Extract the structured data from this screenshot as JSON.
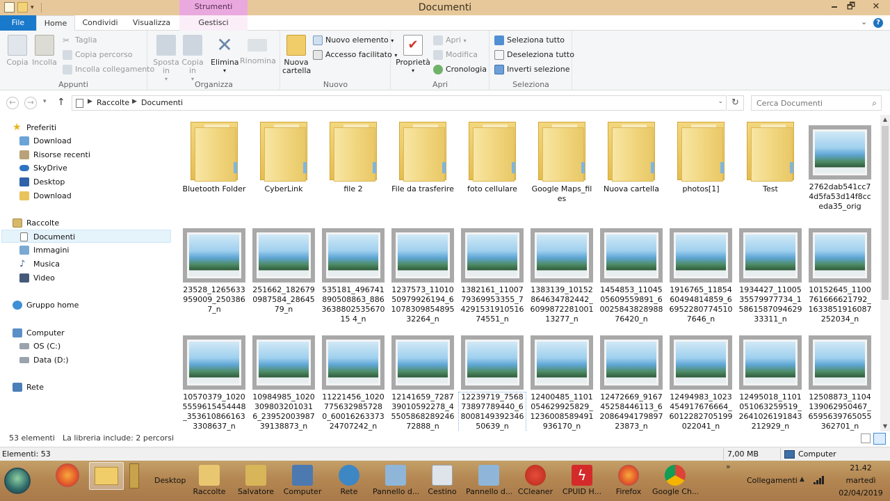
{
  "window": {
    "title": "Documenti",
    "contextual_tab_head": "Strumenti raccolte",
    "minimize": "🗕",
    "maximize": "🗗",
    "close": "✕"
  },
  "tabs": {
    "file": "File",
    "home": "Home",
    "share": "Condividi",
    "view": "Visualizza",
    "manage": "Gestisci",
    "help": "?"
  },
  "ribbon": {
    "clipboard": {
      "label": "Appunti",
      "copy": "Copia",
      "paste": "Incolla",
      "cut": "Taglia",
      "copy_path": "Copia percorso",
      "paste_link": "Incolla collegamento"
    },
    "organize": {
      "label": "Organizza",
      "move_to": "Sposta in",
      "copy_to": "Copia in",
      "delete": "Elimina",
      "rename": "Rinomina"
    },
    "new": {
      "label": "Nuovo",
      "new_folder": "Nuova cartella",
      "new_item": "Nuovo elemento",
      "easy_access": "Accesso facilitato"
    },
    "open": {
      "label": "Apri",
      "properties": "Proprietà",
      "open": "Apri",
      "edit": "Modifica",
      "history": "Cronologia"
    },
    "select": {
      "label": "Seleziona",
      "select_all": "Seleziona tutto",
      "select_none": "Deseleziona tutto",
      "invert": "Inverti selezione"
    }
  },
  "address": {
    "crumbs": [
      "Raccolte",
      "Documenti"
    ],
    "search_placeholder": "Cerca Documenti"
  },
  "navpane": {
    "favorites": "Preferiti",
    "fav_items": [
      "Download",
      "Risorse recenti",
      "SkyDrive",
      "Desktop",
      "Download"
    ],
    "libraries": "Raccolte",
    "lib_items": [
      "Documenti",
      "Immagini",
      "Musica",
      "Video"
    ],
    "homegroup": "Gruppo home",
    "computer": "Computer",
    "drives": [
      "OS (C:)",
      "Data (D:)"
    ],
    "network": "Rete"
  },
  "files": [
    {
      "type": "folder",
      "name": "Bluetooth Folder"
    },
    {
      "type": "folder",
      "name": "CyberLink"
    },
    {
      "type": "folder",
      "name": "file 2"
    },
    {
      "type": "folder",
      "name": "File da trasferire"
    },
    {
      "type": "folder",
      "name": "foto cellulare"
    },
    {
      "type": "folder",
      "name": "Google Maps_files"
    },
    {
      "type": "folder",
      "name": "Nuova cartella"
    },
    {
      "type": "folder",
      "name": "photos[1]"
    },
    {
      "type": "folder",
      "name": "Test"
    },
    {
      "type": "image",
      "name": "2762dab541cc74d5fa53d14f8cceda35_orig"
    },
    {
      "type": "image",
      "name": "23528_1265633959009_2503867_n"
    },
    {
      "type": "image",
      "name": "251662_1826790987584_2864579_n"
    },
    {
      "type": "image",
      "name": "535181_496741890508863_886363880253567015 4_n"
    },
    {
      "type": "image",
      "name": "1237573_1101050979926194_6107830985489532264_n"
    },
    {
      "type": "image",
      "name": "1382161_1100779369953355_7429153191051674551_n"
    },
    {
      "type": "image",
      "name": "1383139_10152864634782442_609987228100113277_n"
    },
    {
      "type": "image",
      "name": "1454853_1104505609559891_6002584382898876420_n"
    },
    {
      "type": "image",
      "name": "1916765_1185460494814859_669522807745107646_n"
    },
    {
      "type": "image",
      "name": "1934427_1100535579977734_1586158709462933311_n"
    },
    {
      "type": "image",
      "name": "10152645_1100761666621792_1633851916087252034_n"
    },
    {
      "type": "image",
      "name": "10570379_10205559615454448_3536108661633308637_n"
    },
    {
      "type": "image",
      "name": "10984985_1020309803201031 6_2395200398739138873_n"
    },
    {
      "type": "image",
      "name": "11221456_1020775632985728 0_6001626337324707242_n"
    },
    {
      "type": "image",
      "name": "12141659_728739010592278_4550586828924672888_n"
    },
    {
      "type": "image",
      "name": "12239719_756873897789440_6800814939234650639_n"
    },
    {
      "type": "image",
      "name": "12400485_1101054629925829_1236008589491936170_n"
    },
    {
      "type": "image",
      "name": "12472669_916745258446113_6208649417989723873_n"
    },
    {
      "type": "image",
      "name": "12494983_1023454917676664_6012282705199022041_n"
    },
    {
      "type": "image",
      "name": "12495018_1101051063259519_2641026191843212929_n"
    },
    {
      "type": "image",
      "name": "12508873_1104139062950467_6595639765055362701_n"
    }
  ],
  "status": {
    "count": "53 elementi",
    "libinfo": "La libreria include: 2 percorsi"
  },
  "details": {
    "left": "Elementi: 53",
    "size": "7,00 MB",
    "zone": "Computer"
  },
  "taskbar": {
    "desktop_label": "Desktop",
    "items": [
      "Raccolte",
      "Salvatore",
      "Computer",
      "Rete",
      "Pannello d...",
      "Cestino",
      "Pannello d...",
      "CCleaner",
      "CPUID H...",
      "Firefox",
      "Google Ch..."
    ],
    "expand": "»",
    "links_label": "Collegamenti",
    "tray_up": "▲",
    "time": "21.42",
    "day": "martedì",
    "date": "02/04/2019"
  }
}
